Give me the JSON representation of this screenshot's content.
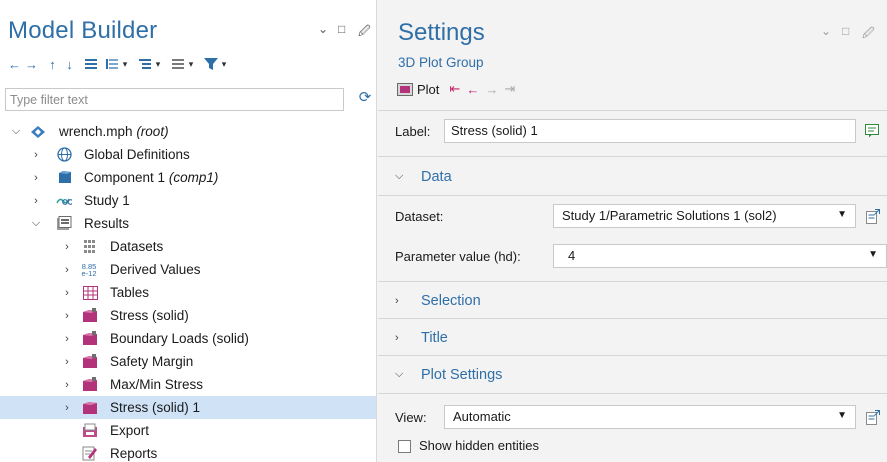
{
  "colors": {
    "accent": "#2f6fa8",
    "selection": "#cfe2f6",
    "results_icon": "#b3337a",
    "panel_bg": "#f3f3f3"
  },
  "model_builder": {
    "title": "Model Builder",
    "filter_placeholder": "Type filter text",
    "toolbar_icons": [
      "arrow-left-icon",
      "arrow-right-icon",
      "arrow-up-icon",
      "arrow-down-icon",
      "collapse-all-icon",
      "expand-options-icon",
      "tree-view-icon",
      "list-view-icon",
      "filter-icon"
    ],
    "tree": [
      {
        "label": "wrench.mph",
        "suffix": "(root)",
        "expanded": true,
        "icon": "model-icon"
      },
      {
        "label": "Global Definitions",
        "icon": "globe-icon"
      },
      {
        "label": "Component 1",
        "suffix": "(comp1)",
        "icon": "component-icon"
      },
      {
        "label": "Study 1",
        "icon": "study-icon"
      },
      {
        "label": "Results",
        "expanded": true,
        "icon": "results-icon"
      },
      {
        "label": "Datasets",
        "icon": "datasets-icon"
      },
      {
        "label": "Derived Values",
        "icon": "derived-values-icon",
        "icon_text_top": "8.85",
        "icon_text_bottom": "e-12"
      },
      {
        "label": "Tables",
        "icon": "table-icon"
      },
      {
        "label": "Stress (solid)",
        "icon": "plot-group-3d-icon"
      },
      {
        "label": "Boundary Loads (solid)",
        "icon": "plot-group-3d-icon"
      },
      {
        "label": "Safety Margin",
        "icon": "plot-group-3d-icon"
      },
      {
        "label": "Max/Min Stress",
        "icon": "plot-group-3d-icon"
      },
      {
        "label": "Stress (solid) 1",
        "icon": "plot-group-3d-icon",
        "selected": true
      },
      {
        "label": "Export",
        "icon": "export-icon"
      },
      {
        "label": "Reports",
        "icon": "reports-icon"
      }
    ]
  },
  "settings": {
    "title": "Settings",
    "subtitle": "3D Plot Group",
    "plot_button": "Plot",
    "label_field": {
      "label": "Label:",
      "value": "Stress (solid) 1"
    },
    "sections": {
      "data": "Data",
      "selection": "Selection",
      "title": "Title",
      "plot_settings": "Plot Settings"
    },
    "dataset": {
      "label": "Dataset:",
      "value": "Study 1/Parametric Solutions 1 (sol2)"
    },
    "parameter": {
      "label": "Parameter value (hd):",
      "value": "4"
    },
    "view": {
      "label": "View:",
      "value": "Automatic"
    },
    "show_hidden": {
      "label": "Show hidden entities",
      "checked": false
    }
  }
}
